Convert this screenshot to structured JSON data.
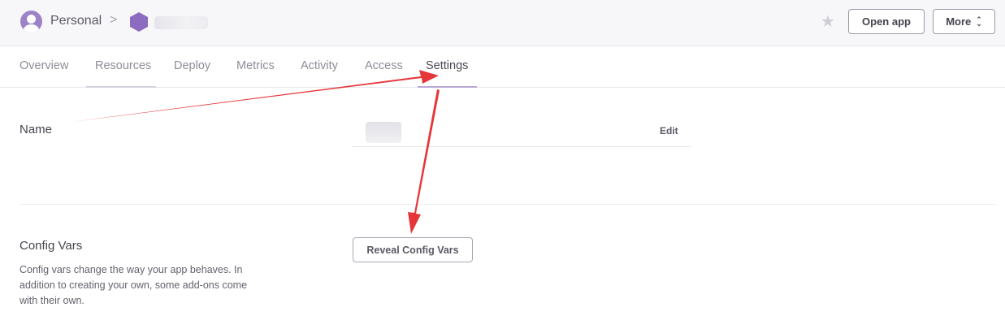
{
  "header": {
    "breadcrumb_personal": "Personal",
    "breadcrumb_separator": ">",
    "open_app_label": "Open app",
    "more_label": "More",
    "icons": [
      "user-avatar-icon",
      "app-hexagon-icon",
      "star-icon",
      "chevron-updown-icon"
    ]
  },
  "tabs": [
    {
      "label": "Overview"
    },
    {
      "label": "Resources"
    },
    {
      "label": "Deploy"
    },
    {
      "label": "Metrics"
    },
    {
      "label": "Activity"
    },
    {
      "label": "Access"
    },
    {
      "label": "Settings",
      "active": true
    }
  ],
  "name_section": {
    "label": "Name",
    "edit_label": "Edit"
  },
  "config_vars": {
    "title": "Config Vars",
    "description": "Config vars change the way your app behaves. In addition to creating your own, some add-ons come with their own.",
    "reveal_label": "Reveal Config Vars"
  },
  "colors": {
    "accent_purple": "#79589f",
    "annotation_red": "#e5373a",
    "tab_underline": "#b9a8d4"
  }
}
